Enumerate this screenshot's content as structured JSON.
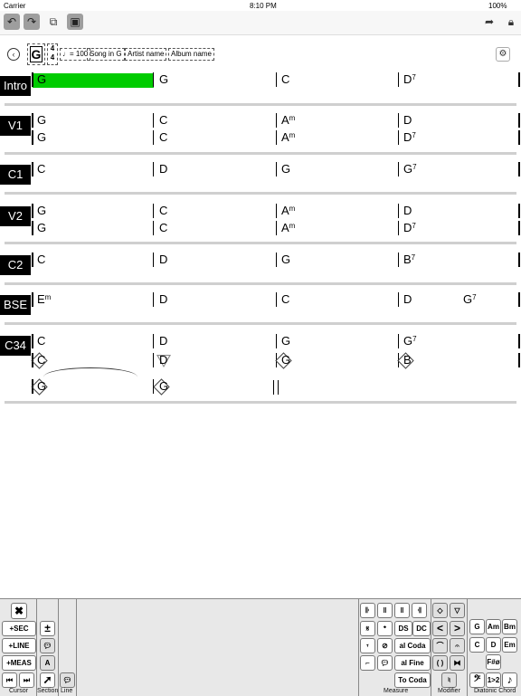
{
  "status": {
    "carrier": "Carrier",
    "time": "8:10 PM",
    "battery": "100%"
  },
  "toolbar": {
    "icons": [
      "undo-icon",
      "redo-icon",
      "copy-icon",
      "paste-icon",
      "share-icon",
      "lock-icon"
    ]
  },
  "header": {
    "key": "G",
    "time_sig_top": "4",
    "time_sig_bottom": "4",
    "tempo": "♩= 100",
    "song": "Song in G",
    "artist": "Artist name",
    "album": "Album name"
  },
  "sections": [
    {
      "label": "Intro",
      "rows": [
        [
          "G",
          "G",
          "C",
          "D7"
        ]
      ]
    },
    {
      "label": "V1",
      "rows": [
        [
          "G",
          "C",
          "Am",
          "D"
        ],
        [
          "G",
          "C",
          "Am",
          "D7"
        ]
      ]
    },
    {
      "label": "C1",
      "rows": [
        [
          "C",
          "D",
          "G",
          "G7"
        ]
      ]
    },
    {
      "label": "V2",
      "rows": [
        [
          "G",
          "C",
          "Am",
          "D"
        ],
        [
          "G",
          "C",
          "Am",
          "D7"
        ]
      ]
    },
    {
      "label": "C2",
      "rows": [
        [
          "C",
          "D",
          "G",
          "B7"
        ]
      ]
    },
    {
      "label": "BSE",
      "rows": [
        [
          "Em",
          "D",
          "C",
          "D",
          "G7"
        ]
      ]
    },
    {
      "label": "C34",
      "rows": [
        [
          "C",
          "D",
          "G",
          "G7"
        ],
        [
          "C",
          "D",
          "G",
          "B"
        ],
        [
          "G",
          "G"
        ]
      ]
    }
  ],
  "palette": {
    "cursor": {
      "close": "✖",
      "sec": "+SEC",
      "line": "+LINE",
      "meas": "+MEAS",
      "label": "Cursor"
    },
    "section": {
      "label": "Section",
      "a": "A"
    },
    "line": {
      "label": "Line"
    },
    "measure": {
      "ds": "DS",
      "dc": "DC",
      "alcoda": "al Coda",
      "alfine": "al Fine",
      "tocoda": "To Coda",
      "label": "Measure"
    },
    "modifier": {
      "label": "Modifier"
    },
    "diatonic": {
      "label": "Diatonic Chord",
      "chords": [
        "G",
        "Am",
        "Bm",
        "C",
        "D",
        "Em",
        "F#ø"
      ],
      "toggle": "1>2"
    }
  }
}
